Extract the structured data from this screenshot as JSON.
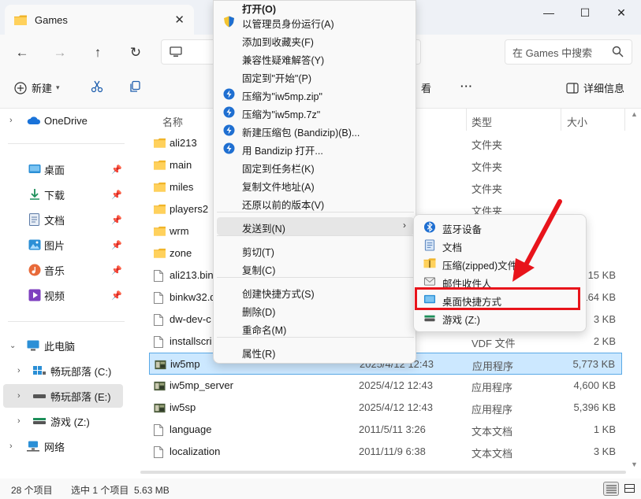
{
  "window": {
    "tab_title": "Games",
    "tab_close": "✕",
    "min": "—",
    "max": "☐",
    "close": "✕"
  },
  "nav": {
    "back": "←",
    "forward": "→",
    "up": "↑",
    "refresh": "↻"
  },
  "search": {
    "placeholder": "在 Games 中搜索"
  },
  "commandbar": {
    "new_label": "新建",
    "sort_partial": "看",
    "more": "···",
    "details_label": "详细信息"
  },
  "sidebar": {
    "onedrive": "OneDrive",
    "quick": [
      {
        "label": "桌面"
      },
      {
        "label": "下载"
      },
      {
        "label": "文档"
      },
      {
        "label": "图片"
      },
      {
        "label": "音乐"
      },
      {
        "label": "视频"
      }
    ],
    "thispc": "此电脑",
    "drives": [
      {
        "label": "畅玩部落 (C:)"
      },
      {
        "label": "畅玩部落 (E:)"
      },
      {
        "label": "游戏 (Z:)"
      }
    ],
    "network": "网络"
  },
  "columns": {
    "name": "名称",
    "type": "类型",
    "size": "大小"
  },
  "files": [
    {
      "name": "ali213",
      "date": ":09",
      "type": "文件夹",
      "size": "",
      "kind": "folder"
    },
    {
      "name": "main",
      "date": ":11",
      "type": "文件夹",
      "size": "",
      "kind": "folder"
    },
    {
      "name": "miles",
      "date": ":11",
      "type": "文件夹",
      "size": "",
      "kind": "folder"
    },
    {
      "name": "players2",
      "date": ":11",
      "type": "文件夹",
      "size": "",
      "kind": "folder"
    },
    {
      "name": "wrm",
      "date": "",
      "type": "",
      "size": "",
      "kind": "folder"
    },
    {
      "name": "zone",
      "date": "",
      "type": "",
      "size": "",
      "kind": "folder"
    },
    {
      "name": "ali213.bin",
      "date": "",
      "type": "",
      "size": "15 KB",
      "kind": "file"
    },
    {
      "name": "binkw32.d",
      "date": "",
      "type": "",
      "size": "164 KB",
      "kind": "file"
    },
    {
      "name": "dw-dev-c",
      "date": "",
      "type": "",
      "size": "3 KB",
      "kind": "file"
    },
    {
      "name": "installscri",
      "date": ":53",
      "type": "VDF 文件",
      "size": "2 KB",
      "kind": "file"
    },
    {
      "name": "iw5mp",
      "date": "2025/4/12 12:43",
      "type": "应用程序",
      "size": "5,773 KB",
      "kind": "exe"
    },
    {
      "name": "iw5mp_server",
      "date": "2025/4/12 12:43",
      "type": "应用程序",
      "size": "4,600 KB",
      "kind": "exe"
    },
    {
      "name": "iw5sp",
      "date": "2025/4/12 12:43",
      "type": "应用程序",
      "size": "5,396 KB",
      "kind": "exe"
    },
    {
      "name": "language",
      "date": "2011/5/11 3:26",
      "type": "文本文档",
      "size": "1 KB",
      "kind": "file"
    },
    {
      "name": "localization",
      "date": "2011/11/9 6:38",
      "type": "文本文档",
      "size": "3 KB",
      "kind": "file"
    }
  ],
  "status": {
    "count": "28 个项目",
    "selection": "选中 1 个项目  5.63 MB"
  },
  "context_menu": {
    "items": [
      {
        "label": "打开(O)",
        "icon": "none"
      },
      {
        "label": "以管理员身份运行(A)",
        "icon": "shield-icon"
      },
      {
        "label": "添加到收藏夹(F)",
        "icon": "none"
      },
      {
        "label": "兼容性疑难解答(Y)",
        "icon": "none"
      },
      {
        "label": "固定到\"开始\"(P)",
        "icon": "none"
      },
      {
        "label": "压缩为\"iw5mp.zip\"",
        "icon": "bandizip-icon"
      },
      {
        "label": "压缩为\"iw5mp.7z\"",
        "icon": "bandizip-icon"
      },
      {
        "label": "新建压缩包 (Bandizip)(B)...",
        "icon": "bandizip-icon"
      },
      {
        "label": "用 Bandizip 打开...",
        "icon": "bandizip-icon"
      },
      {
        "label": "固定到任务栏(K)",
        "icon": "none"
      },
      {
        "label": "复制文件地址(A)",
        "icon": "none"
      },
      {
        "label": "还原以前的版本(V)",
        "icon": "none"
      },
      {
        "label": "发送到(N)",
        "icon": "none"
      },
      {
        "label": "剪切(T)",
        "icon": "none"
      },
      {
        "label": "复制(C)",
        "icon": "none"
      },
      {
        "label": "创建快捷方式(S)",
        "icon": "none"
      },
      {
        "label": "删除(D)",
        "icon": "none"
      },
      {
        "label": "重命名(M)",
        "icon": "none"
      },
      {
        "label": "属性(R)",
        "icon": "none"
      }
    ],
    "submenu_arrow": "›"
  },
  "submenu": {
    "items": [
      {
        "label": "蓝牙设备"
      },
      {
        "label": "文档"
      },
      {
        "label": "压缩(zipped)文件"
      },
      {
        "label": "邮件收件人"
      },
      {
        "label": "桌面快捷方式"
      },
      {
        "label": "游戏 (Z:)"
      }
    ]
  },
  "colors": {
    "accent": "#0067c0",
    "highlight_red": "#e8141b",
    "selection_bg": "#cce8ff"
  }
}
